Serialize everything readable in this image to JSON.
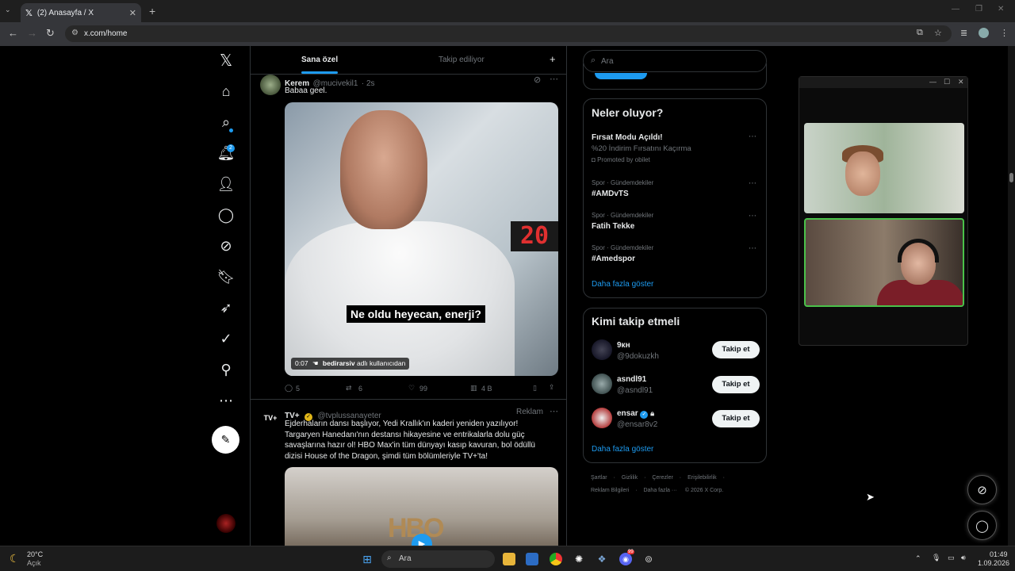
{
  "browser": {
    "tab_title": "(2) Anasayfa / X",
    "url": "x.com/home",
    "new_tab_symbol": "+"
  },
  "nav": {
    "notification_count": "2",
    "items": [
      "home-icon",
      "search-icon",
      "bell-icon",
      "add-user-icon",
      "message-icon",
      "grok-icon",
      "bookmark-icon",
      "rocket-icon",
      "verified-icon",
      "profile-icon",
      "more-icon"
    ]
  },
  "timeline": {
    "tabs": [
      "Sana özel",
      "Takip ediliyor"
    ],
    "add_symbol": "+",
    "tweet1": {
      "name": "Kerem",
      "handle": "@mucivekil1",
      "time": "· 2s",
      "text": "Babaa geel.",
      "clock_text": "20",
      "subtitle": "Ne oldu heyecan, enerji?",
      "video_time": "0:07",
      "video_user": "bedirarsiv",
      "video_user_suffix": "adlı kullanıcıdan",
      "replies": "5",
      "retweets": "6",
      "likes": "99",
      "views": "4 B"
    },
    "tweet2": {
      "name": "TV+",
      "handle": "@tvplussanayeter",
      "ad_label": "Reklam",
      "avatar_text": "TV+",
      "text": "Ejderhaların dansı başlıyor, Yedi Krallık'ın kaderi yeniden yazılıyor! Targaryen Hanedanı'nın destansı hikayesine ve entrikalarla dolu güç savaşlarına hazır ol! HBO Max'in tüm dünyayı kasıp kavuran, bol ödüllü dizisi House of the Dragon, şimdi tüm bölümleriyle TV+'ta!",
      "media_text": "HBO"
    }
  },
  "sidebar": {
    "search_placeholder": "Ara",
    "trends_title": "Neler oluyor?",
    "trends": [
      {
        "meta": "",
        "name": "Fırsat Modu Açıldı!",
        "sub": "%20 İndirim Fırsatını Kaçırma",
        "promo": "Promoted by obilet"
      },
      {
        "meta": "Spor · Gündemdekiler",
        "name": "#AMDvTS"
      },
      {
        "meta": "Spor · Gündemdekiler",
        "name": "Fatih Tekke"
      },
      {
        "meta": "Spor · Gündemdekiler",
        "name": "#Amedspor"
      }
    ],
    "trends_more": "Daha fazla göster",
    "who_title": "Kimi takip etmeli",
    "who": [
      {
        "name": "9кн",
        "handle": "@9dokuzkh",
        "button": "Takip et"
      },
      {
        "name": "asndl91",
        "handle": "@asndl91",
        "button": "Takip et"
      },
      {
        "name": "ensar",
        "handle": "@ensar8v2",
        "button": "Takip et"
      }
    ],
    "who_more": "Daha fazla göster",
    "footer": [
      "Şartlar",
      "·",
      "Gizlilik",
      "·",
      "Çerezler",
      "·",
      "Erişilebilirlik",
      "·"
    ],
    "footer2": [
      "Reklam Bilgileri",
      "·",
      "Daha fazla ···",
      "© 2026 X Corp."
    ]
  },
  "taskbar": {
    "weather_temp": "20°C",
    "weather_desc": "Açık",
    "search_placeholder": "Ara",
    "time": "01:49",
    "date": "1.09.2026",
    "discord_badge": "99"
  },
  "colors": {
    "accent": "#1d9bf0",
    "background": "#000000",
    "border": "#2f3336"
  }
}
